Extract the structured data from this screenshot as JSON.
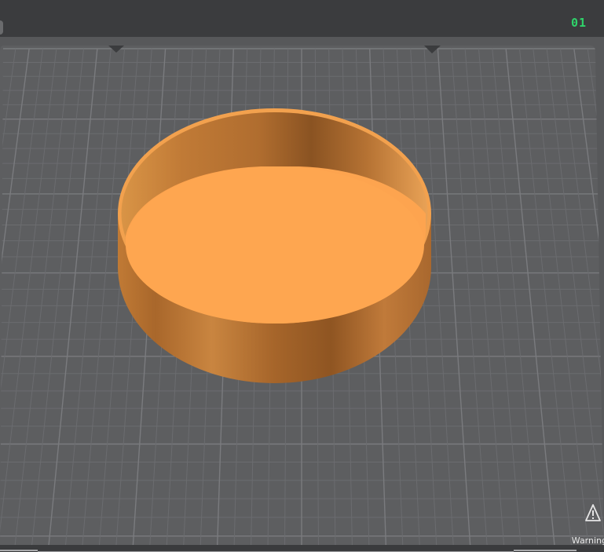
{
  "plate": {
    "number": "01"
  },
  "status": {
    "warning_label": "Warning"
  },
  "model": {
    "shape": "open-cylinder-tray",
    "color": "#f7a24c"
  },
  "bed": {
    "grid": true,
    "color": "#5d5e60"
  },
  "colors": {
    "plate_number": "#2fd36a",
    "topbar": "#3b3c3e"
  }
}
